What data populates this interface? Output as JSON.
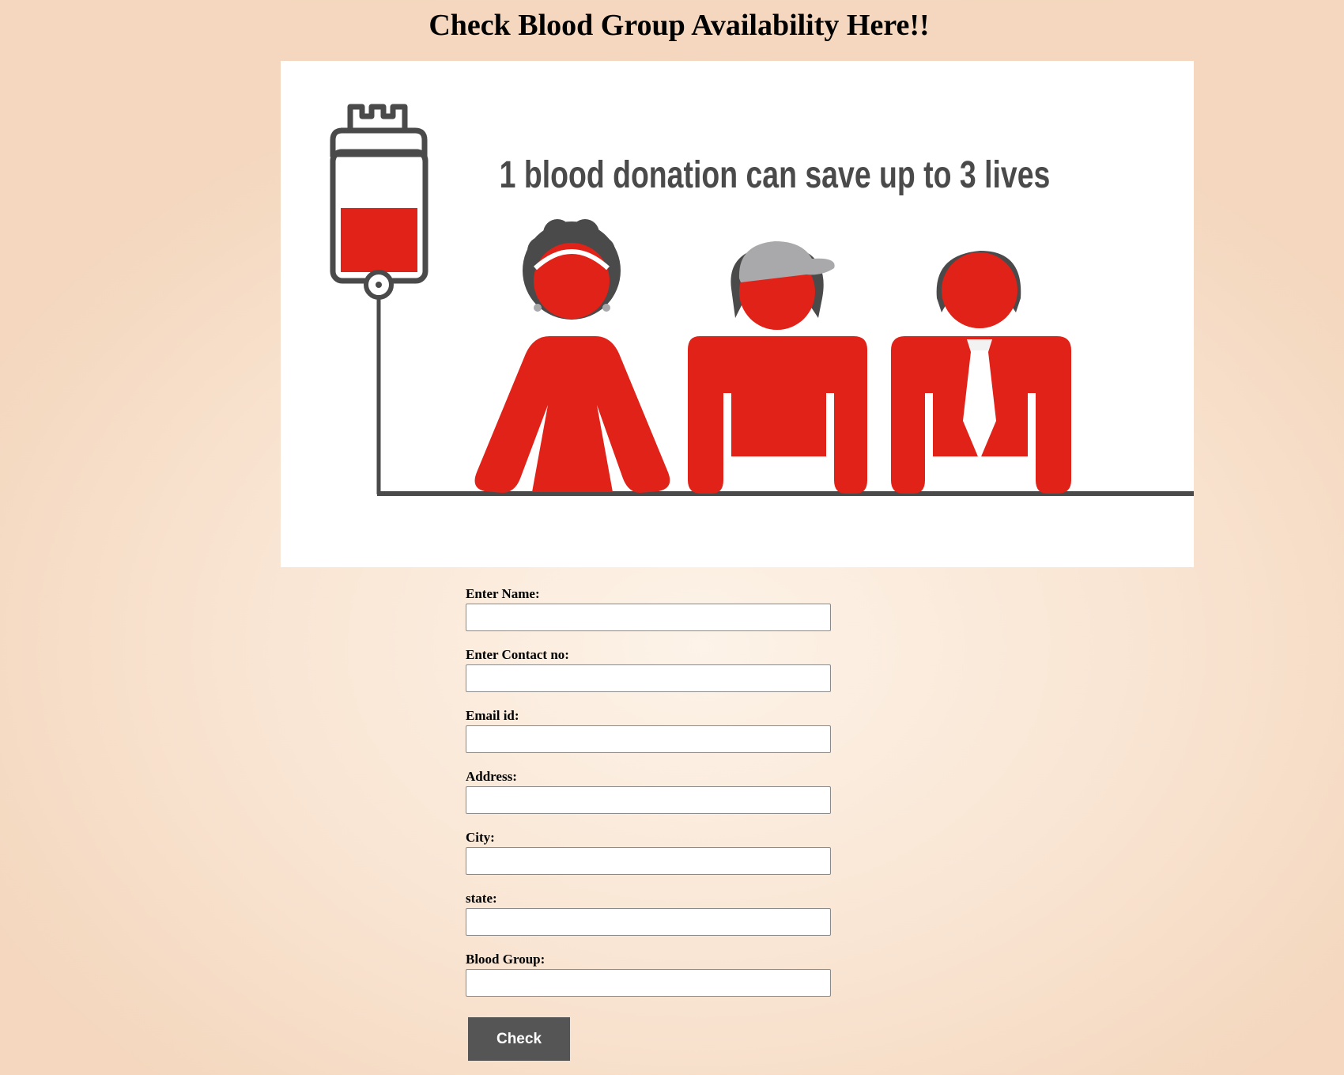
{
  "page": {
    "title": "Check Blood Group Availability Here!!"
  },
  "banner": {
    "caption": "1 blood donation can save up to 3 lives",
    "colors": {
      "blood_red": "#e02219",
      "outline_gray": "#4a4a4a",
      "cap_gray": "#a9a9ab"
    }
  },
  "form": {
    "fields": [
      {
        "label": "Enter Name:",
        "value": "",
        "placeholder": ""
      },
      {
        "label": "Enter Contact no:",
        "value": "",
        "placeholder": ""
      },
      {
        "label": "Email id:",
        "value": "",
        "placeholder": ""
      },
      {
        "label": "Address:",
        "value": "",
        "placeholder": ""
      },
      {
        "label": "City:",
        "value": "",
        "placeholder": ""
      },
      {
        "label": "state:",
        "value": "",
        "placeholder": ""
      },
      {
        "label": "Blood Group:",
        "value": "",
        "placeholder": ""
      }
    ],
    "submit_label": "Check"
  },
  "theme": {
    "background": "#f7dfca",
    "button_bg": "#555555",
    "button_text": "#ffffff"
  }
}
